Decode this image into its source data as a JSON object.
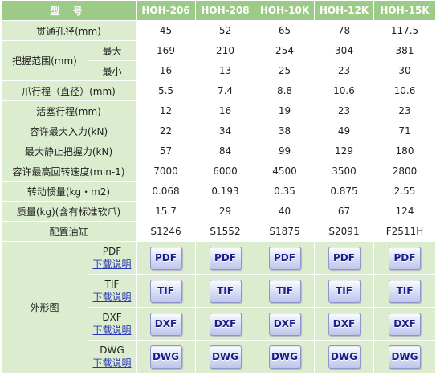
{
  "header": {
    "title": "型 号",
    "models": [
      "HOH-206",
      "HOH-208",
      "HOH-10K",
      "HOH-12K",
      "HOH-15K"
    ]
  },
  "rows": {
    "bore": {
      "label": "贯通孔径(mm)",
      "values": [
        "45",
        "52",
        "65",
        "78",
        "117.5"
      ]
    },
    "grip_label": "把握范围(mm)",
    "grip_max": {
      "label": "最大",
      "values": [
        "169",
        "210",
        "254",
        "304",
        "381"
      ]
    },
    "grip_min": {
      "label": "最小",
      "values": [
        "16",
        "13",
        "25",
        "23",
        "30"
      ]
    },
    "jaw_stroke": {
      "label": "爪行程（直径）(mm)",
      "values": [
        "5.5",
        "7.4",
        "8.8",
        "10.6",
        "10.6"
      ]
    },
    "piston": {
      "label": "活塞行程(mm)",
      "values": [
        "12",
        "16",
        "19",
        "23",
        "23"
      ]
    },
    "max_input": {
      "label": "容许最大入力(kN)",
      "values": [
        "22",
        "34",
        "38",
        "49",
        "71"
      ]
    },
    "max_grip": {
      "label": "最大静止把握力(kN)",
      "values": [
        "57",
        "84",
        "99",
        "129",
        "180"
      ]
    },
    "max_speed": {
      "label": "容许最高回转速度(min-1)",
      "values": [
        "7000",
        "6000",
        "4500",
        "3500",
        "2800"
      ]
    },
    "inertia": {
      "label": "转动惯量(kg・m2)",
      "values": [
        "0.068",
        "0.193",
        "0.35",
        "0.875",
        "2.55"
      ]
    },
    "mass": {
      "label": "质量(kg)(含有标准软爪)",
      "values": [
        "15.7",
        "29",
        "40",
        "67",
        "124"
      ]
    },
    "cylinder": {
      "label": "配置油缸",
      "values": [
        "S1246",
        "S1552",
        "S1875",
        "S2091",
        "F2511H"
      ]
    }
  },
  "outline": {
    "label": "外形图",
    "download_text": "下载说明",
    "formats": [
      {
        "name": "PDF",
        "button": "PDF"
      },
      {
        "name": "TIF",
        "button": "TIF"
      },
      {
        "name": "DXF",
        "button": "DXF"
      },
      {
        "name": "DWG",
        "button": "DWG"
      }
    ]
  },
  "colors": {
    "header_bg": "#9ccb87",
    "label_bg": "#dbeccf",
    "link": "#2a36b6",
    "button_text": "#1a1f8a"
  }
}
